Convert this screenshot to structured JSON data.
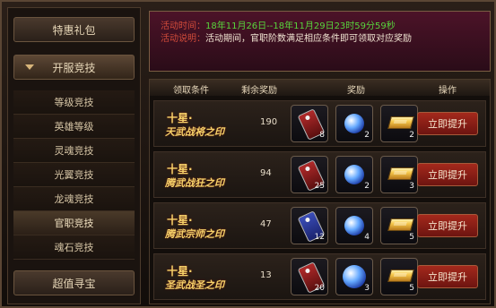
{
  "sidebar": {
    "top_button": "特惠礼包",
    "section_button": "开服竞技",
    "items": [
      "等级竞技",
      "英雄等级",
      "灵魂竞技",
      "光翼竞技",
      "龙魂竞技",
      "官职竞技",
      "魂石竞技"
    ],
    "selected_item": "官职竞技",
    "bottom_button": "超值寻宝"
  },
  "info": {
    "time_label": "活动时间：",
    "time_value": "18年11月26日--18年11月29日23时59分59秒",
    "desc_label": "活动说明：",
    "desc_value": "活动期间，官职阶数满足相应条件即可领取对应奖励"
  },
  "table": {
    "headers": {
      "condition": "领取条件",
      "remaining": "剩余奖励",
      "reward": "奖励",
      "action": "操作"
    },
    "rows": [
      {
        "title_line1": "十星·",
        "title_line2": "天武战将之印",
        "remaining": "190",
        "rewards": [
          {
            "icon": "seal-tag-icon",
            "count": "8"
          },
          {
            "icon": "blue-orb-icon",
            "count": "2"
          },
          {
            "icon": "gold-bar-icon",
            "count": "2"
          }
        ],
        "button": "立即提升"
      },
      {
        "title_line1": "十星·",
        "title_line2": "腾武战狂之印",
        "remaining": "94",
        "rewards": [
          {
            "icon": "seal-tag-icon",
            "count": "25"
          },
          {
            "icon": "blue-orb-icon",
            "count": "2"
          },
          {
            "icon": "gold-bar-icon",
            "count": "3"
          }
        ],
        "button": "立即提升"
      },
      {
        "title_line1": "十星·",
        "title_line2": "腾武宗师之印",
        "remaining": "47",
        "rewards": [
          {
            "icon": "seal-tag-icon",
            "count": "12"
          },
          {
            "icon": "blue-orb-icon",
            "count": "4"
          },
          {
            "icon": "gold-bar-icon",
            "count": "5"
          }
        ],
        "button": "立即提升"
      },
      {
        "title_line1": "十星·",
        "title_line2": "圣武战圣之印",
        "remaining": "13",
        "rewards": [
          {
            "icon": "seal-tag-icon",
            "count": "20"
          },
          {
            "icon": "blue-orb-icon",
            "count": "3"
          },
          {
            "icon": "gold-bar-icon",
            "count": "5"
          }
        ],
        "button": "立即提升"
      }
    ]
  },
  "colors": {
    "accent_red": "#d14b3a",
    "accent_green": "#58d53d",
    "gold_text": "#f6d36a"
  }
}
